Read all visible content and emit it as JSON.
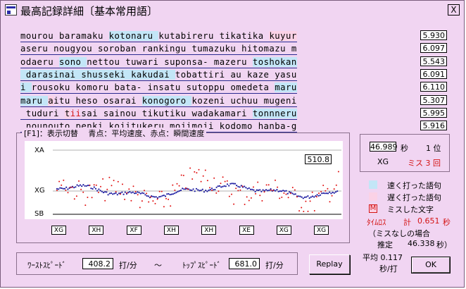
{
  "window": {
    "title": "最高記録詳細〔基本常用語〕",
    "close_label": "X"
  },
  "typing_lines": [
    {
      "score": "5.930",
      "segments": [
        {
          "t": "mourou ",
          "k": "normal"
        },
        {
          "t": "baramaku ",
          "k": "normal"
        },
        {
          "t": "kotonaru ",
          "k": "fast"
        },
        {
          "t": "kutabireru tikatika ",
          "k": "normal"
        },
        {
          "t": "kuyur",
          "k": "slow"
        }
      ]
    },
    {
      "score": "6.097",
      "segments": [
        {
          "t": "aseru nougyou soroban rankingu tumazuku hitomazu m",
          "k": "normal"
        }
      ]
    },
    {
      "score": "5.543",
      "segments": [
        {
          "t": "odaeru ",
          "k": "normal"
        },
        {
          "t": "sono ",
          "k": "fast"
        },
        {
          "t": "nettou tuwari suponsa- mazeru ",
          "k": "normal"
        },
        {
          "t": "toshokan",
          "k": "fast"
        }
      ]
    },
    {
      "score": "6.091",
      "segments": [
        {
          "t": " darasinai shusseki ",
          "k": "fast"
        },
        {
          "t": "kakudai ",
          "k": "fast"
        },
        {
          "t": "tobattiri au kaze yasu",
          "k": "normal"
        }
      ]
    },
    {
      "score": "6.110",
      "segments": [
        {
          "t": "i ",
          "k": "fast"
        },
        {
          "t": "rousoku komoru bata- insatu sutoppu omedeta ",
          "k": "normal"
        },
        {
          "t": "maru",
          "k": "fast"
        }
      ]
    },
    {
      "score": "5.307",
      "segments": [
        {
          "t": "maru ",
          "k": "fast"
        },
        {
          "t": "a",
          "k": "slow"
        },
        {
          "t": "itu heso osarai ",
          "k": "normal"
        },
        {
          "t": "konogoro ",
          "k": "fast"
        },
        {
          "t": "kozeni uchuu mugeni",
          "k": "normal"
        }
      ]
    },
    {
      "score": "5.995",
      "segments": [
        {
          "t": " tuduri ",
          "k": "normal"
        },
        {
          "t": "t",
          "k": "slow"
        },
        {
          "t": "ii",
          "k": "miss"
        },
        {
          "t": "sai ",
          "k": "normal"
        },
        {
          "t": "sainou tikutiku wadakamari ",
          "k": "normal"
        },
        {
          "t": "tonnneru",
          "k": "fast"
        }
      ]
    },
    {
      "score": "5.916",
      "segments": [
        {
          "t": " nounouto ",
          "k": "normal"
        },
        {
          "t": "penki kojitukeru mojimoji kodomo hanba-g",
          "k": "normal"
        }
      ]
    }
  ],
  "graph": {
    "label": "[F1]：表示切替　 青点：平均速度、赤点：瞬間速度",
    "axis_top": "XA",
    "axis_mid": "XG",
    "axis_bottom": "SB",
    "current_value": "510.8",
    "keys": [
      "XG",
      "XH",
      "XF",
      "XH",
      "XH",
      "XE",
      "XG",
      "XG"
    ],
    "colors": {
      "average": "#1a1aa0",
      "instant": "#e01010",
      "baseline": "#000000",
      "grid": "#b0b0b0"
    }
  },
  "rank": {
    "time": "46.989",
    "time_unit": "秒",
    "rank_label": "1 位",
    "level": "XG",
    "miss_label": "ミス 3 回"
  },
  "legend": [
    {
      "label": "速く打った語句",
      "color": "#c3e6f7"
    },
    {
      "label": "遅く打った語句",
      "color": "#fbd2e6"
    },
    {
      "label": "ミスした文字",
      "mark": "M"
    }
  ],
  "timeloss": {
    "label": "ﾀｲﾑﾛｽ",
    "total_label": "計",
    "value": "0.651",
    "unit": "秒",
    "nomiss_label": "（ミスなしの場合",
    "estimate_label": "推定",
    "estimate_value": "46.338",
    "estimate_unit": "秒）"
  },
  "speed": {
    "worst_label": "ﾜｰｽﾄｽﾋﾟｰﾄﾞ",
    "worst_value": "408.2",
    "unit": "打/分",
    "tilde": "〜",
    "top_label": "ﾄｯﾌﾟｽﾋﾟｰﾄﾞ",
    "top_value": "681.0"
  },
  "average": {
    "label": "平均 0.117",
    "unit": "秒/打"
  },
  "buttons": {
    "replay": "Replay",
    "ok": "OK"
  }
}
